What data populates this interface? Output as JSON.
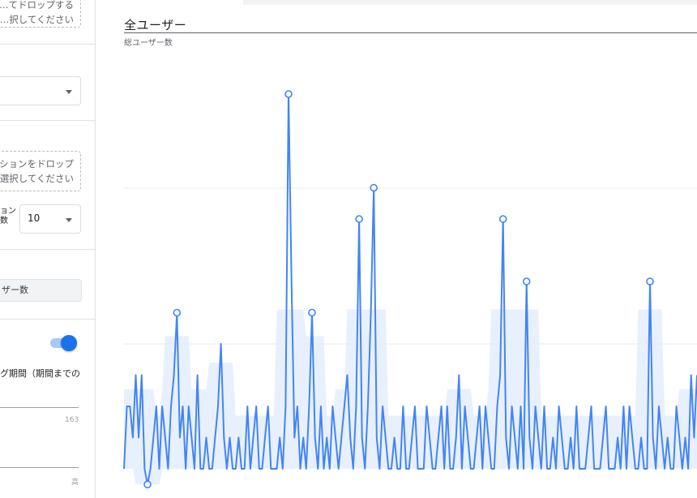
{
  "settings_panel": {
    "dimension_drop_partial": [
      "…てドロップする",
      "…択してください"
    ],
    "secondary_drop_partial": [
      "ションをドロップ",
      "選択してください"
    ],
    "rows_label_partial": [
      "ョン",
      "数"
    ],
    "rows_value": "10",
    "metric_chip": "ザー数",
    "toggle_on": true,
    "comparison_text": "グ期間（期間までの",
    "slider_max": "163",
    "slider_label": "高"
  },
  "chart": {
    "title": "全ユーザー",
    "subtitle": "総ユーザー数",
    "colors": {
      "line": "#4285f4",
      "band": "#e8f0fe",
      "grid": "#e8eaed"
    }
  },
  "chart_data": {
    "type": "line",
    "title": "全ユーザー",
    "ylabel": "総ユーザー数",
    "baseline_level": 0,
    "peak_level": 12,
    "series": [
      {
        "values": [
          0,
          2,
          2,
          1,
          3,
          1,
          3,
          0,
          -0.5,
          0,
          1,
          2,
          0,
          2,
          1,
          0,
          2,
          3,
          5,
          1,
          2,
          0,
          2,
          1,
          0,
          3,
          0,
          0,
          1,
          0,
          0,
          1,
          2,
          4,
          1,
          0,
          1,
          0,
          0,
          1,
          0,
          0,
          2,
          0,
          1,
          2,
          0,
          0,
          1,
          2,
          0,
          0,
          0,
          1,
          0,
          2,
          12,
          6,
          1,
          2,
          0,
          1,
          0,
          2,
          5,
          1,
          0,
          2,
          0,
          1,
          0,
          2,
          1,
          0,
          1,
          2,
          3,
          1,
          0,
          2,
          8,
          1,
          0,
          2,
          5,
          9,
          1,
          0,
          2,
          1,
          0,
          0,
          1,
          0,
          0,
          2,
          0,
          0,
          1,
          2,
          0,
          0,
          0,
          2,
          1,
          0,
          0,
          1,
          2,
          0,
          2,
          0,
          0,
          1,
          3,
          0,
          2,
          1,
          0,
          0,
          1,
          2,
          0,
          2,
          1,
          0,
          0,
          2,
          3,
          8,
          1,
          0,
          2,
          1,
          0,
          2,
          0,
          6,
          1,
          0,
          2,
          1,
          0,
          2,
          0,
          0,
          1,
          0,
          2,
          1,
          0,
          0,
          1,
          0,
          2,
          0,
          0,
          0,
          1,
          2,
          0,
          0,
          0,
          1,
          2,
          0,
          0,
          0,
          1,
          0,
          2,
          0,
          2,
          1,
          0,
          0,
          1,
          0,
          0,
          6,
          1,
          0,
          2,
          1,
          0,
          1,
          0,
          0,
          2,
          1,
          0,
          1,
          0,
          3,
          1,
          3
        ]
      }
    ]
  }
}
